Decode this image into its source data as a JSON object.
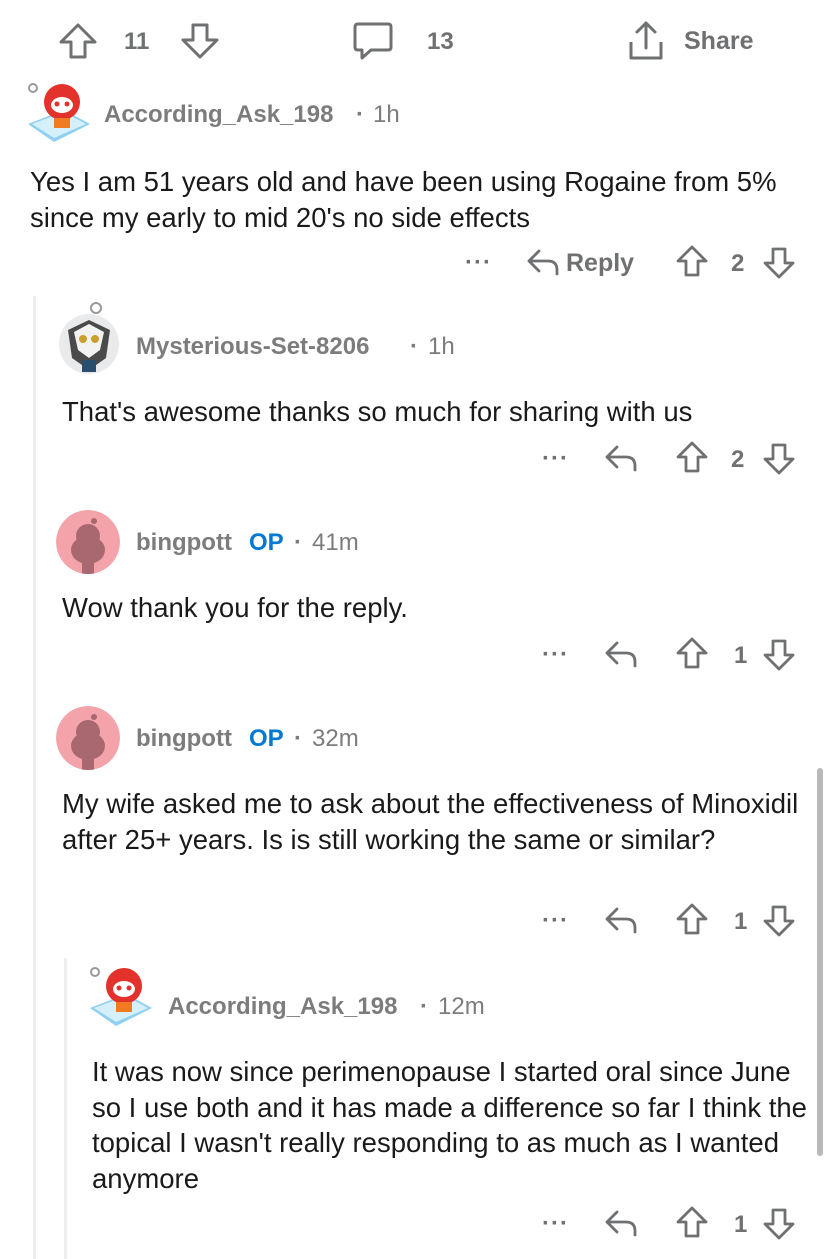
{
  "post_actions": {
    "vote_count": "11",
    "comment_count": "13",
    "share_label": "Share"
  },
  "comments": [
    {
      "username": "According_Ask_198",
      "time": "1h",
      "op": "",
      "body": "Yes I am 51 years old and have been using Rogaine from 5% since my early to mid 20's no side effects",
      "more": "···",
      "reply_label": "Reply",
      "score": "2"
    },
    {
      "username": "Mysterious-Set-8206",
      "time": "1h",
      "op": "",
      "body": "That's awesome thanks so much for sharing with us",
      "more": "···",
      "reply_label": "",
      "score": "2"
    },
    {
      "username": "bingpott",
      "time": "41m",
      "op": "OP",
      "body": "Wow thank you for the reply.",
      "more": "···",
      "reply_label": "",
      "score": "1"
    },
    {
      "username": "bingpott",
      "time": "32m",
      "op": "OP",
      "body": "My wife asked me to ask about the effectiveness of Minoxidil after 25+ years. Is is still working the same or similar?",
      "more": "···",
      "reply_label": "",
      "score": "1"
    },
    {
      "username": "According_Ask_198",
      "time": "12m",
      "op": "",
      "body": "It was now since perimenopause I started oral since June so I use both and it has made a difference so far I think the topical I wasn't really responding to as much as I wanted anymore",
      "more": "···",
      "reply_label": "",
      "score": "1"
    }
  ],
  "separator": "·",
  "colors": {
    "text": "#1a1a1b",
    "meta": "#7c7c7c",
    "op_badge": "#0079d3",
    "thread_line": "#edeff1",
    "bingpott_avatar": "#f4a3ab"
  }
}
